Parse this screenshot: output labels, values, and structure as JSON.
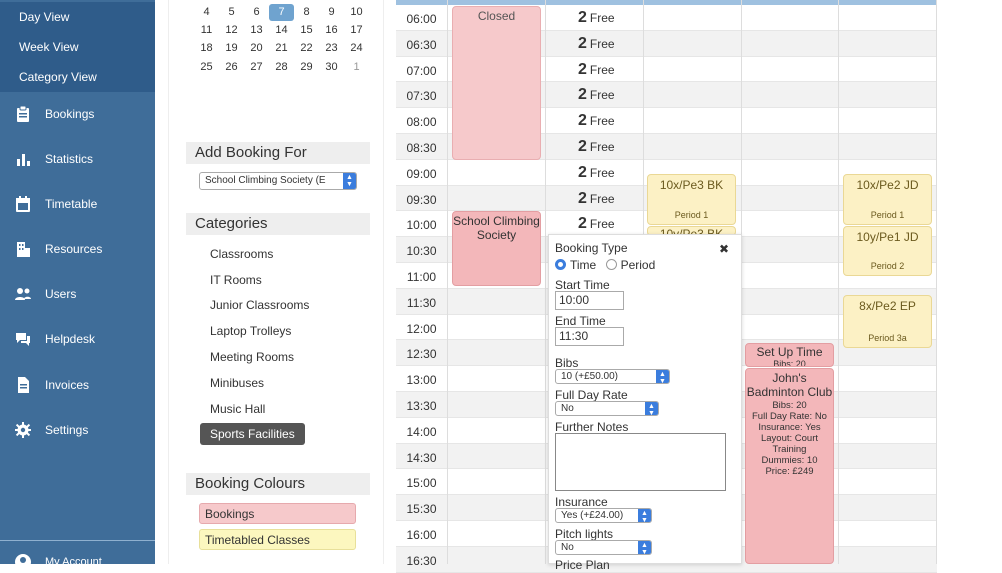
{
  "sidebar": {
    "sub": [
      "Day View",
      "Week View",
      "Category View"
    ],
    "items": [
      {
        "label": "Bookings",
        "icon": "clipboard-icon"
      },
      {
        "label": "Statistics",
        "icon": "bar-chart-icon"
      },
      {
        "label": "Timetable",
        "icon": "calendar-icon"
      },
      {
        "label": "Resources",
        "icon": "building-icon"
      },
      {
        "label": "Users",
        "icon": "users-icon"
      },
      {
        "label": "Helpdesk",
        "icon": "chat-icon"
      },
      {
        "label": "Invoices",
        "icon": "document-icon"
      },
      {
        "label": "Settings",
        "icon": "gear-icon"
      }
    ],
    "account": "My Account"
  },
  "calendar": {
    "rows": [
      [
        "4",
        "5",
        "6",
        "7",
        "8",
        "9",
        "10"
      ],
      [
        "11",
        "12",
        "13",
        "14",
        "15",
        "16",
        "17"
      ],
      [
        "18",
        "19",
        "20",
        "21",
        "22",
        "23",
        "24"
      ],
      [
        "25",
        "26",
        "27",
        "28",
        "29",
        "30",
        "1"
      ]
    ],
    "today": "7"
  },
  "add_booking": {
    "title": "Add Booking For",
    "selected": "School Climbing Society (E"
  },
  "categories": {
    "title": "Categories",
    "items": [
      "Classrooms",
      "IT Rooms",
      "Junior Classrooms",
      "Laptop Trolleys",
      "Meeting Rooms",
      "Minibuses",
      "Music Hall"
    ],
    "active": "Sports Facilities"
  },
  "colours": {
    "title": "Booking Colours",
    "items": [
      "Bookings",
      "Timetabled Classes"
    ],
    "colors": [
      "#f6c9cb",
      "#fcf7bf"
    ]
  },
  "times": [
    "06:00",
    "06:30",
    "07:00",
    "07:30",
    "08:00",
    "08:30",
    "09:00",
    "09:30",
    "10:00",
    "10:30",
    "11:00",
    "11:30",
    "12:00",
    "12:30",
    "13:00",
    "13:30",
    "14:00",
    "14:30",
    "15:00",
    "15:30",
    "16:00",
    "16:30"
  ],
  "free": {
    "count": "2",
    "label": "Free"
  },
  "events": {
    "closed": "Closed",
    "climbing": [
      "School Climbing",
      "Society"
    ],
    "c1": {
      "t": "10x/Pe3 BK",
      "p": "Period 1",
      "t2": "10y/Pe3 BK"
    },
    "c2": [
      {
        "t": "10x/Pe2 JD",
        "p": "Period 1"
      },
      {
        "t": "10y/Pe1 JD",
        "p": "Period 2"
      },
      {
        "t": "8x/Pe2 EP",
        "p": "Period 3a"
      }
    ],
    "setup": {
      "t": "Set Up Time",
      "d": "Bibs: 20"
    },
    "john": {
      "t": [
        "John's",
        "Badminton Club"
      ],
      "d": [
        "Bibs: 20",
        "Full Day Rate: No",
        "Insurance: Yes",
        "Layout: Court",
        "Training",
        "Dummies: 10",
        "Price: £249"
      ]
    }
  },
  "popup": {
    "booking_type": "Booking Type",
    "time": "Time",
    "period": "Period",
    "start_label": "Start Time",
    "start": "10:00",
    "end_label": "End Time",
    "end": "11:30",
    "bibs_label": "Bibs",
    "bibs": "10 (+£50.00)",
    "fdr_label": "Full Day Rate",
    "fdr": "No",
    "notes_label": "Further Notes",
    "ins_label": "Insurance",
    "ins": "Yes (+£24.00)",
    "pitch_label": "Pitch lights",
    "pitch": "No",
    "price_label": "Price Plan",
    "close": "✖"
  }
}
